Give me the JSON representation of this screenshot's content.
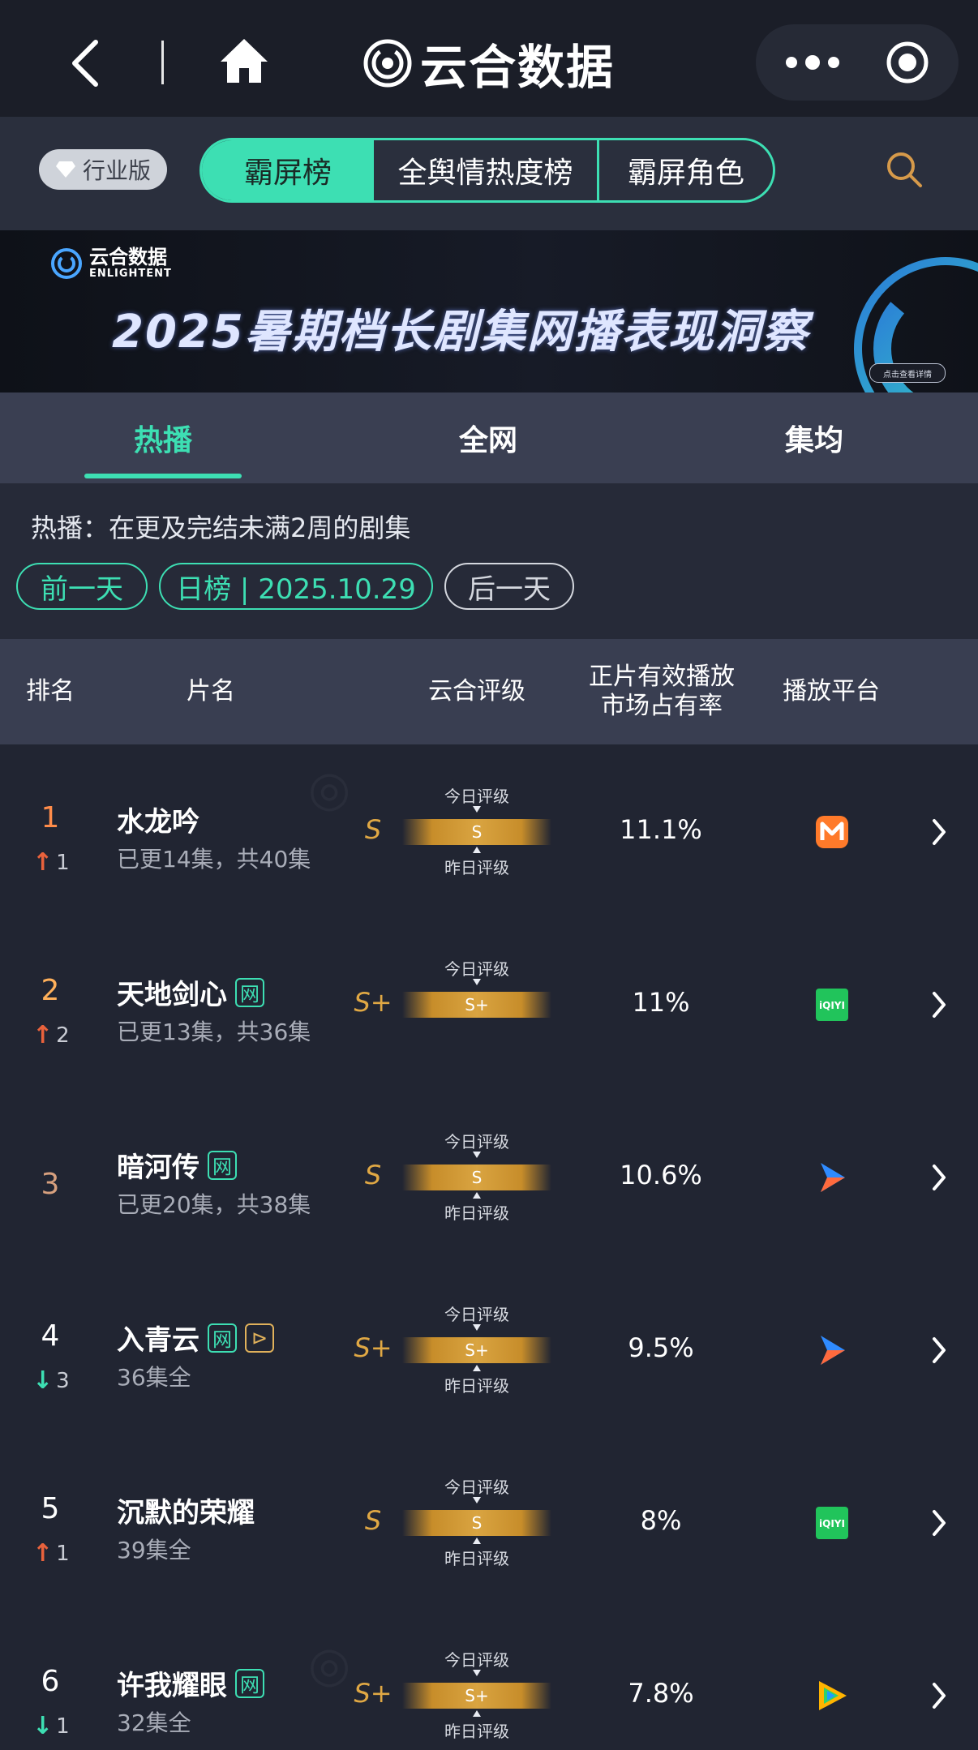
{
  "nav": {
    "title": "云合数据"
  },
  "tab_row": {
    "edition_label": "行业版",
    "tabs": [
      "霸屏榜",
      "全舆情热度榜",
      "霸屏角色"
    ],
    "active_tab": "霸屏榜"
  },
  "banner": {
    "logo_text": "云合数据",
    "logo_sub": "ENLIGHTENT",
    "title": "2025暑期档长剧集网播表现洞察",
    "pill_text": "点击查看详情"
  },
  "sub_tabs": {
    "items": [
      "热播",
      "全网",
      "集均"
    ],
    "active": "热播"
  },
  "filter": {
    "description": "热播：在更及完结未满2周的剧集",
    "prev_label": "前一天",
    "current_label": "日榜 | 2025.10.29",
    "next_label": "后一天"
  },
  "table_header": {
    "rank": "排名",
    "name": "片名",
    "rating": "云合评级",
    "share_line1": "正片有效播放",
    "share_line2": "市场占有率",
    "platform": "播放平台"
  },
  "rating_labels": {
    "today": "今日评级",
    "yesterday": "昨日评级"
  },
  "rows": [
    {
      "rank": "1",
      "change_dir": "up",
      "change": "1",
      "name": "水龙吟",
      "badges": [],
      "episodes": "已更14集，共40集",
      "grade": "S",
      "today_grade": "S",
      "has_yesterday": true,
      "share": "11.1%",
      "platform": "mango-tv-icon"
    },
    {
      "rank": "2",
      "change_dir": "up",
      "change": "2",
      "name": "天地剑心",
      "badges": [
        "网"
      ],
      "episodes": "已更13集，共36集",
      "grade": "S+",
      "today_grade": "S+",
      "has_yesterday": false,
      "share": "11%",
      "platform": "iqiyi-icon"
    },
    {
      "rank": "3",
      "change_dir": "none",
      "change": "",
      "name": "暗河传",
      "badges": [
        "网"
      ],
      "episodes": "已更20集，共38集",
      "grade": "S",
      "today_grade": "S",
      "has_yesterday": true,
      "share": "10.6%",
      "platform": "youku-icon"
    },
    {
      "rank": "4",
      "change_dir": "down",
      "change": "3",
      "name": "入青云",
      "badges": [
        "网",
        "play"
      ],
      "episodes": "36集全",
      "grade": "S+",
      "today_grade": "S+",
      "has_yesterday": true,
      "share": "9.5%",
      "platform": "youku-icon"
    },
    {
      "rank": "5",
      "change_dir": "up",
      "change": "1",
      "name": "沉默的荣耀",
      "badges": [],
      "episodes": "39集全",
      "grade": "S",
      "today_grade": "S",
      "has_yesterday": true,
      "share": "8%",
      "platform": "iqiyi-icon"
    },
    {
      "rank": "6",
      "change_dir": "down",
      "change": "1",
      "name": "许我耀眼",
      "badges": [
        "网"
      ],
      "episodes": "32集全",
      "grade": "S+",
      "today_grade": "S+",
      "has_yesterday": true,
      "share": "7.8%",
      "platform": "tencent-video-icon"
    }
  ],
  "colors": {
    "accent": "#3ddfb3",
    "grade_gold": "#e0a844",
    "rank_up": "#e9623c",
    "rank_down": "#3ddfb3"
  }
}
